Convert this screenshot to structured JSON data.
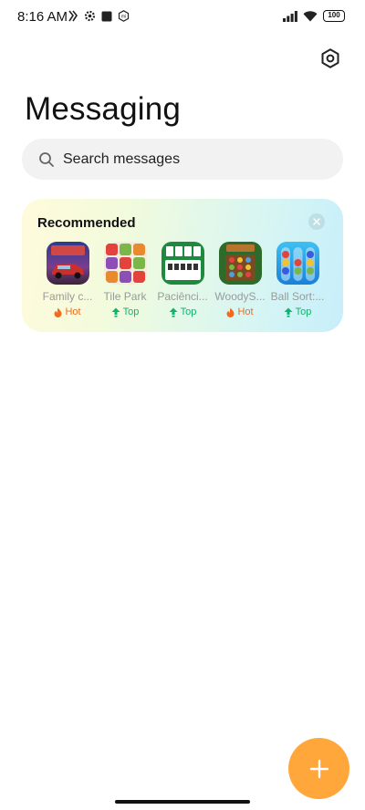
{
  "status_bar": {
    "time": "8:16 AM",
    "battery": "100"
  },
  "header": {
    "title": "Messaging"
  },
  "search": {
    "placeholder": "Search messages"
  },
  "recommended": {
    "title": "Recommended",
    "apps": [
      {
        "name": "Family c...",
        "badge": "Hot"
      },
      {
        "name": "Tile Park",
        "badge": "Top"
      },
      {
        "name": "Paciênci...",
        "badge": "Top"
      },
      {
        "name": "WoodyS...",
        "badge": "Hot"
      },
      {
        "name": "Ball Sort:...",
        "badge": "Top"
      }
    ]
  },
  "colors": {
    "fab": "#ffa73a",
    "hot": "#f26b1d",
    "top": "#11b26b"
  },
  "icons": {
    "settings": "settings-hex-icon",
    "search": "search-icon",
    "close": "close-icon",
    "fab": "plus-icon"
  }
}
